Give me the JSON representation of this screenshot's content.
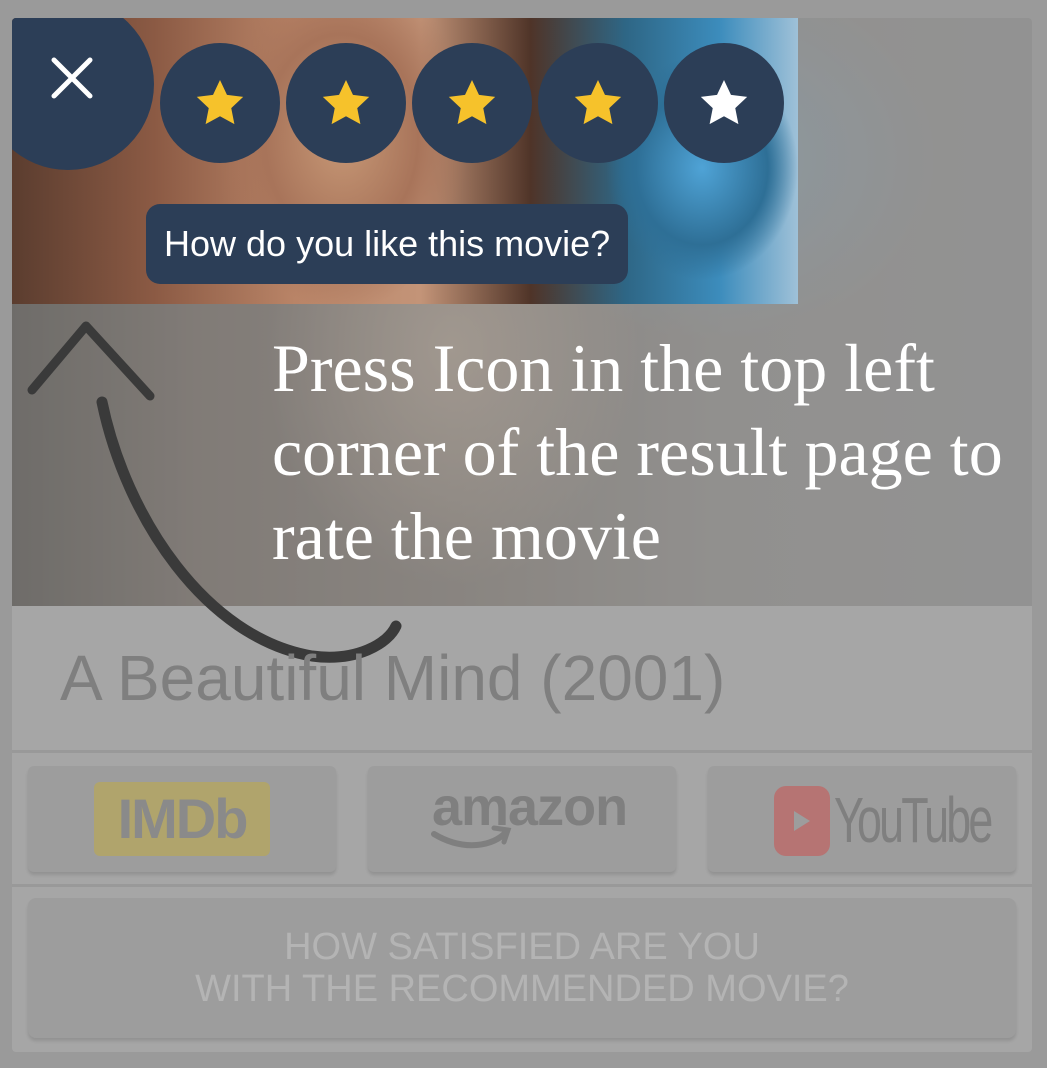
{
  "rating_popup": {
    "close_icon": "close-icon",
    "stars": [
      {
        "icon": "star-icon",
        "color": "#f6c22b"
      },
      {
        "icon": "star-icon",
        "color": "#f6c22b"
      },
      {
        "icon": "star-icon",
        "color": "#f6c22b"
      },
      {
        "icon": "star-icon",
        "color": "#f6c22b"
      },
      {
        "icon": "star-icon",
        "color": "#ffffff"
      }
    ],
    "rating": 4,
    "max_rating": 5,
    "prompt": "How do you like this movie?"
  },
  "instruction": {
    "text": "Press Icon in the top left corner of the result page to rate the movie"
  },
  "movie": {
    "title": "A Beautiful Mind (2001)"
  },
  "links": {
    "imdb_label": "IMDb",
    "amazon_label": "amazon",
    "youtube_label": "YouTube"
  },
  "satisfaction": {
    "line1": "HOW SATISFIED ARE YOU",
    "line2": "WITH THE RECOMMENDED MOVIE?"
  },
  "colors": {
    "popup_bg": "#2c3e57",
    "star_filled": "#f6c22b",
    "star_empty": "#ffffff",
    "overlay": "#9a9a9a"
  }
}
